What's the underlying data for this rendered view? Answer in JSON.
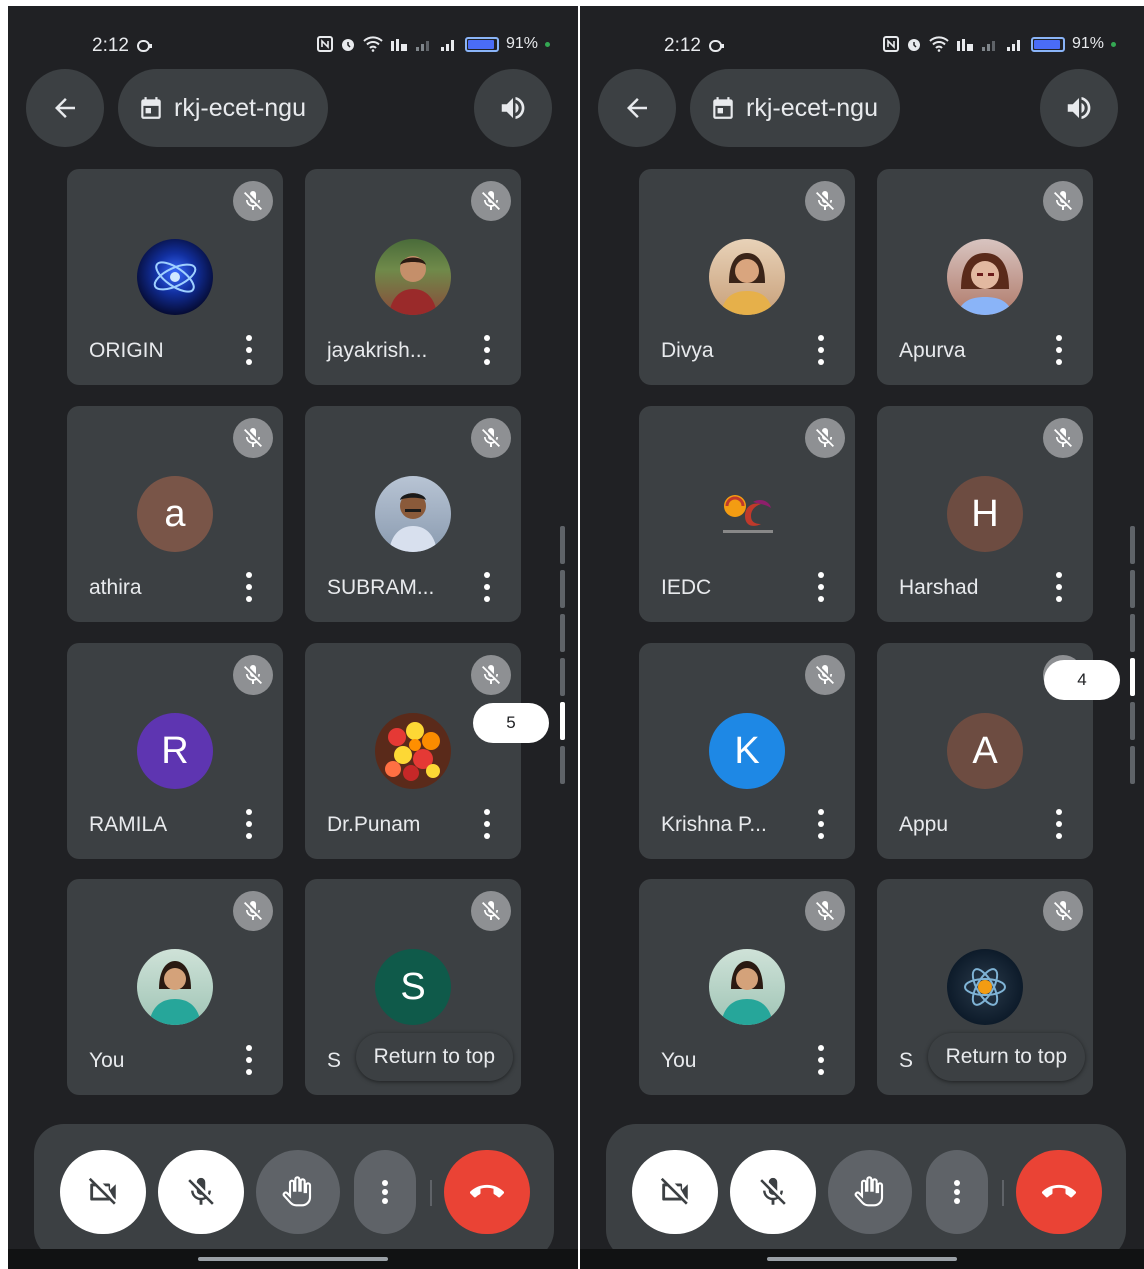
{
  "status": {
    "time": "2:12",
    "battery": "91%"
  },
  "meeting": {
    "code": "rkj-ecet-ngu"
  },
  "controls": [
    "camera-off",
    "mic-off",
    "raise-hand",
    "more-options",
    "leave-call"
  ],
  "return_to_top": "Return to top",
  "left_screen": {
    "page_number": "5",
    "tiles": [
      {
        "name": "ORIGIN",
        "avatar": {
          "type": "image",
          "color": "#0a1a5c"
        }
      },
      {
        "name": "jayakrish...",
        "avatar": {
          "type": "image",
          "color": "#7a5a3c"
        }
      },
      {
        "name": "athira",
        "avatar": {
          "type": "letter",
          "letter": "a",
          "color": "#795548"
        }
      },
      {
        "name": "SUBRAM...",
        "avatar": {
          "type": "image",
          "color": "#8a9bb0"
        }
      },
      {
        "name": "RAMILA",
        "avatar": {
          "type": "letter",
          "letter": "R",
          "color": "#5e35b1"
        }
      },
      {
        "name": "Dr.Punam",
        "avatar": {
          "type": "image",
          "color": "#d84315"
        }
      },
      {
        "name": "You",
        "avatar": {
          "type": "image",
          "color": "#4db6ac"
        }
      },
      {
        "name": "S",
        "avatar": {
          "type": "letter",
          "letter": "S",
          "color": "#0f5a4a"
        }
      }
    ]
  },
  "right_screen": {
    "page_number": "4",
    "tiles": [
      {
        "name": "Divya",
        "avatar": {
          "type": "image",
          "color": "#c8a07a"
        }
      },
      {
        "name": "Apurva",
        "avatar": {
          "type": "image",
          "color": "#b07a6a"
        }
      },
      {
        "name": "IEDC",
        "avatar": {
          "type": "image",
          "color": "#3c4043"
        }
      },
      {
        "name": "Harshad",
        "avatar": {
          "type": "letter",
          "letter": "H",
          "color": "#6d4c41"
        }
      },
      {
        "name": "Krishna P...",
        "avatar": {
          "type": "letter",
          "letter": "K",
          "color": "#1e88e5"
        }
      },
      {
        "name": "Appu",
        "avatar": {
          "type": "letter",
          "letter": "A",
          "color": "#6d4c41"
        }
      },
      {
        "name": "You",
        "avatar": {
          "type": "image",
          "color": "#4db6ac"
        }
      },
      {
        "name": "S",
        "avatar": {
          "type": "image",
          "color": "#0d1b2a"
        }
      }
    ]
  }
}
